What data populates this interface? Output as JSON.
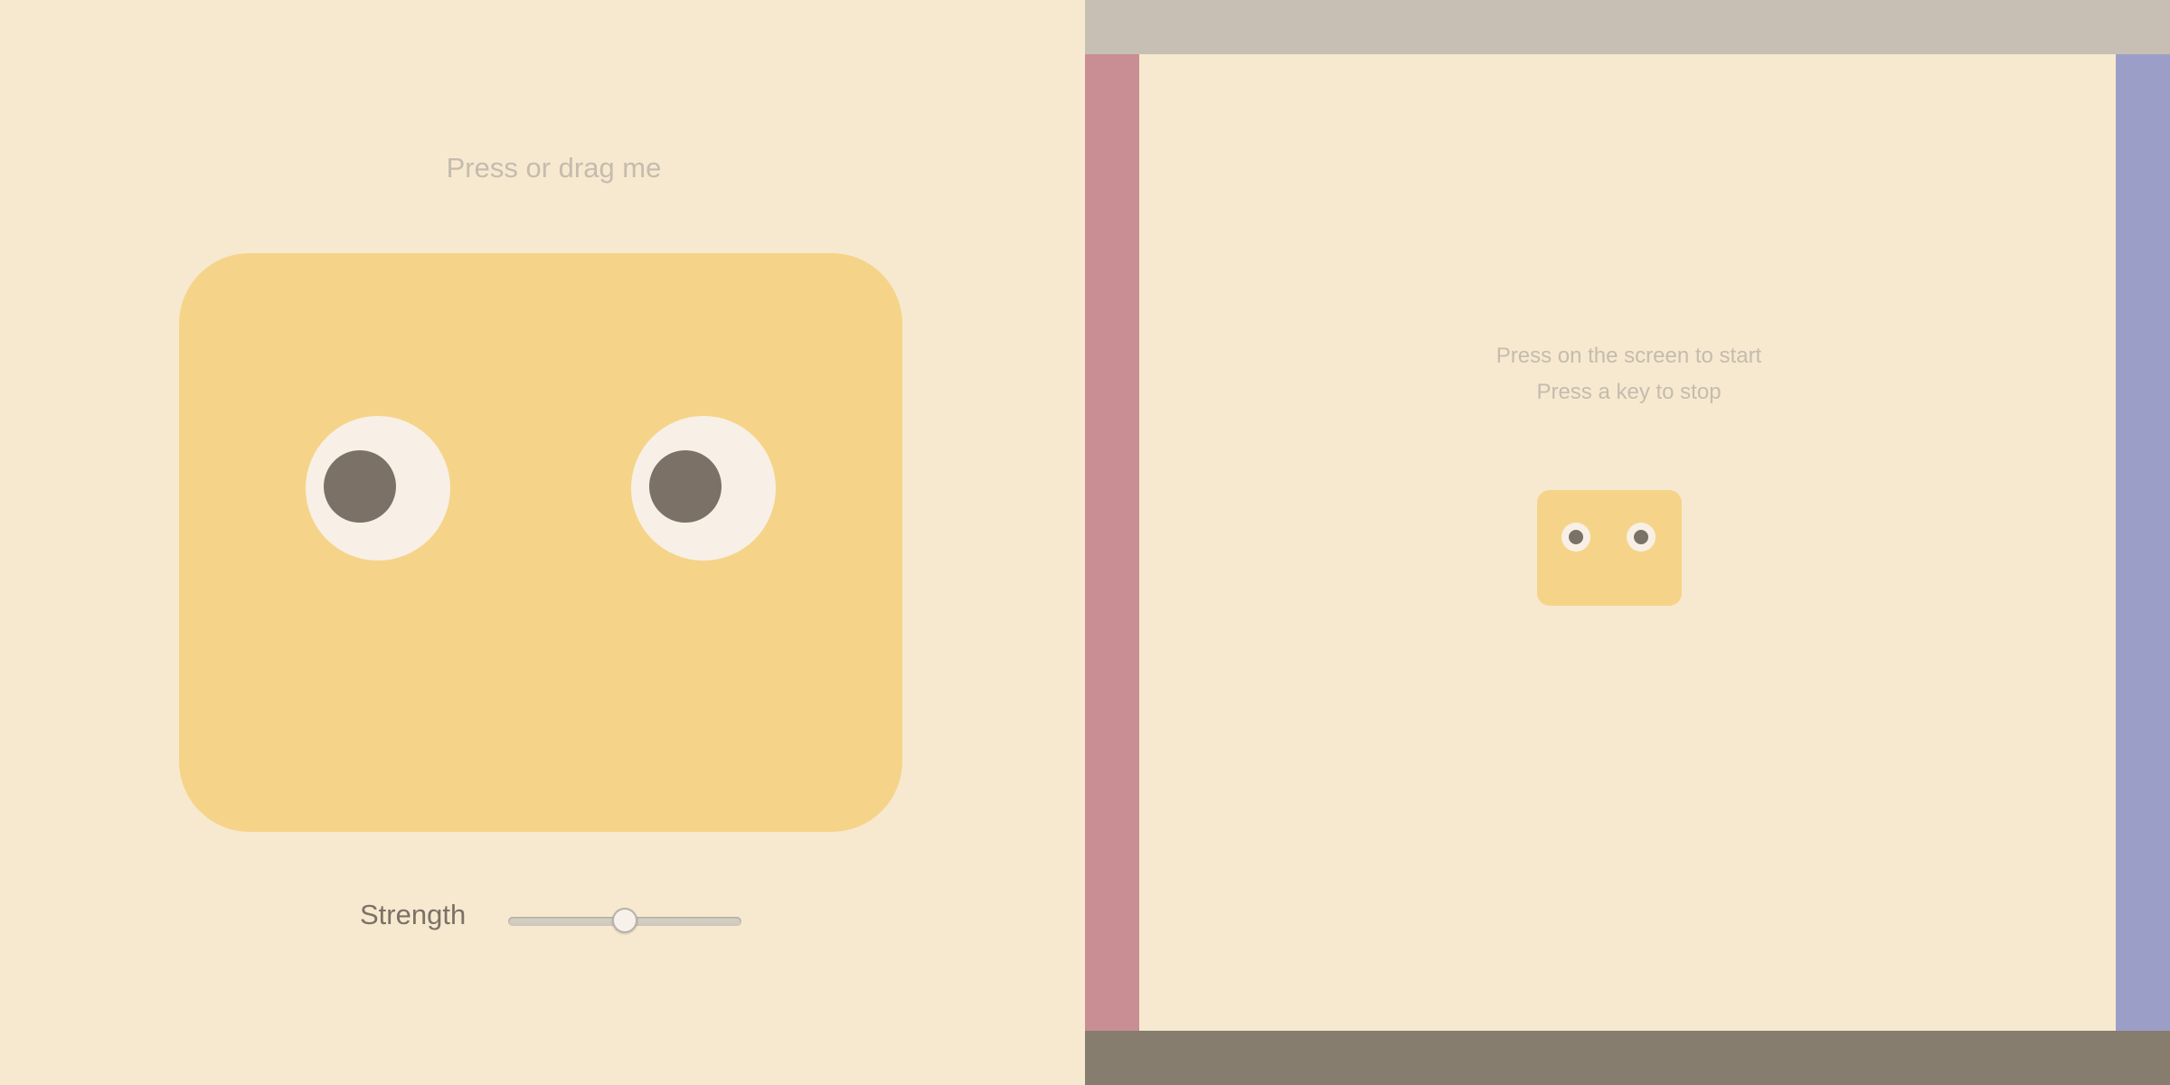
{
  "left_panel": {
    "hint": "Press or drag me",
    "strength_label": "Strength",
    "strength_slider": {
      "min": 0,
      "max": 100,
      "value": 50
    },
    "colors": {
      "background": "#f7e9cf",
      "creature": "#f5d489",
      "eye_white": "#f8f0e6",
      "pupil": "#7b7166"
    }
  },
  "right_panel": {
    "instructions": {
      "line1": "Press on the screen to start",
      "line2": "Press a key to stop"
    },
    "walls": {
      "top": "#c7bfb3",
      "bottom": "#877d6f",
      "left": "#c88e94",
      "right": "#9b9fc7"
    }
  }
}
